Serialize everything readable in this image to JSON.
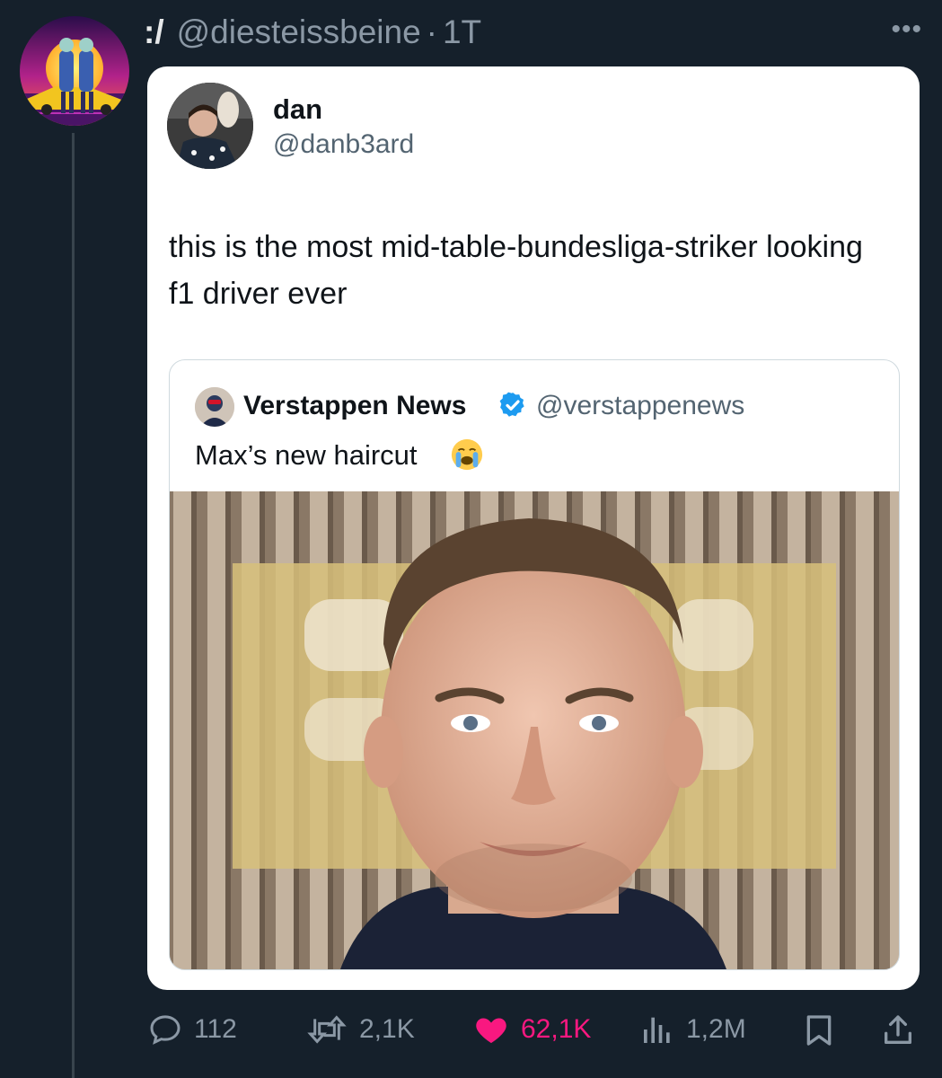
{
  "post": {
    "display_name": ":/",
    "handle": "@diesteissbeine",
    "separator": "·",
    "time": "1T",
    "more_icon": "more-dots-icon"
  },
  "quoted_tweet": {
    "name": "dan",
    "handle": "@danb3ard",
    "text": "this is the most mid-table-bundesliga-striker looking f1 driver ever"
  },
  "nested_quote": {
    "name": "Verstappen News",
    "verified_icon": "verified-badge-icon",
    "handle": "@verstappenews",
    "text": "Max’s new haircut",
    "emoji": "loudly-crying-face-icon"
  },
  "actions": {
    "replies": "112",
    "reposts": "2,1K",
    "likes": "62,1K",
    "views": "1,2M"
  },
  "colors": {
    "background": "#15202b",
    "muted": "#8b98a5",
    "like_active": "#f91880",
    "verified": "#1d9bf0"
  }
}
